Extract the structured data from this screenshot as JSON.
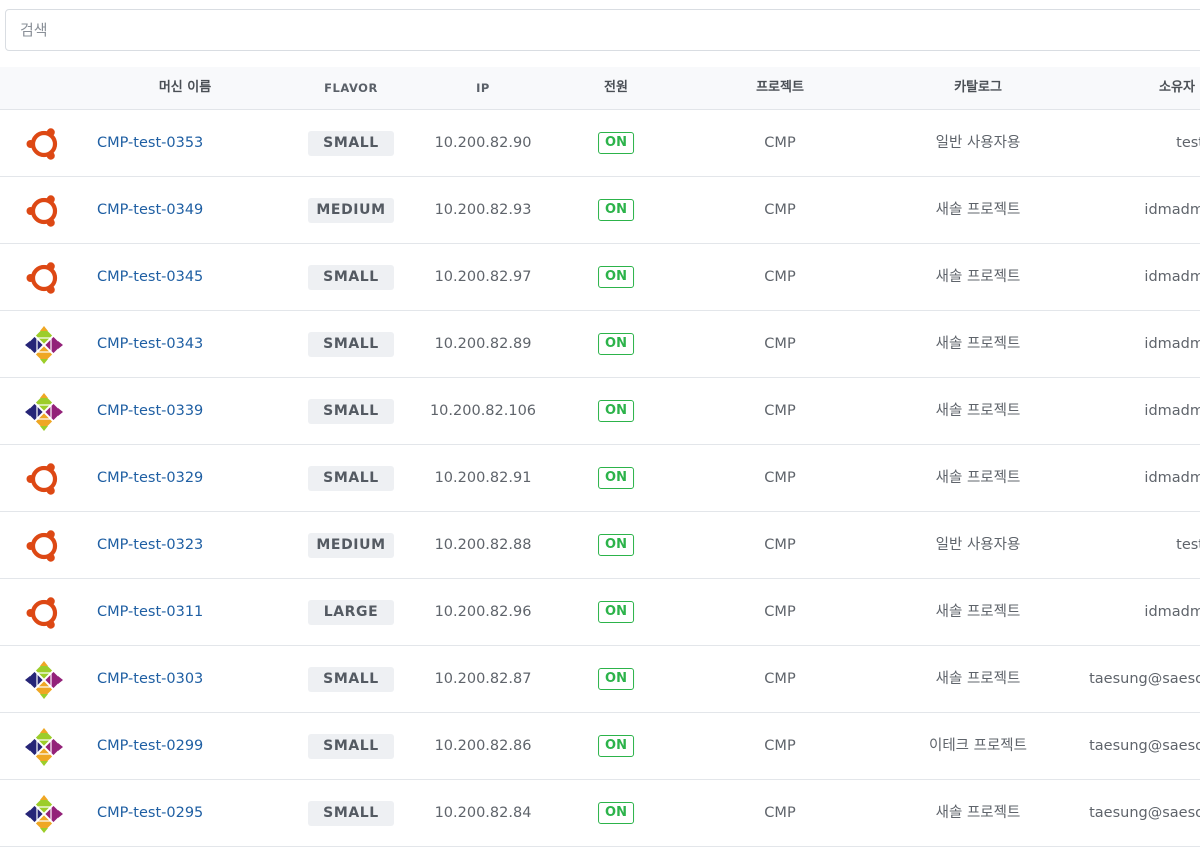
{
  "search": {
    "placeholder": "검색"
  },
  "columns": {
    "name": "머신 이름",
    "flavor": "FLAVOR",
    "ip": "IP",
    "power": "전원",
    "project": "프로젝트",
    "catalog": "카탈로그",
    "owner": "소유자"
  },
  "colors": {
    "link": "#1f5fa3",
    "power_on": "#2cb34a",
    "ubuntu": "#dd4814",
    "header_bg": "#f8f9fb"
  },
  "rows": [
    {
      "os_icon": "ubuntu-icon",
      "name": "CMP-test-0353",
      "flavor": "SMALL",
      "ip": "10.200.82.90",
      "power": "ON",
      "project": "CMP",
      "catalog": "일반 사용자용",
      "owner": "test"
    },
    {
      "os_icon": "ubuntu-icon",
      "name": "CMP-test-0349",
      "flavor": "MEDIUM",
      "ip": "10.200.82.93",
      "power": "ON",
      "project": "CMP",
      "catalog": "새솔 프로젝트",
      "owner": "idmadm"
    },
    {
      "os_icon": "ubuntu-icon",
      "name": "CMP-test-0345",
      "flavor": "SMALL",
      "ip": "10.200.82.97",
      "power": "ON",
      "project": "CMP",
      "catalog": "새솔 프로젝트",
      "owner": "idmadm"
    },
    {
      "os_icon": "centos-icon",
      "name": "CMP-test-0343",
      "flavor": "SMALL",
      "ip": "10.200.82.89",
      "power": "ON",
      "project": "CMP",
      "catalog": "새솔 프로젝트",
      "owner": "idmadm"
    },
    {
      "os_icon": "centos-icon",
      "name": "CMP-test-0339",
      "flavor": "SMALL",
      "ip": "10.200.82.106",
      "power": "ON",
      "project": "CMP",
      "catalog": "새솔 프로젝트",
      "owner": "idmadm"
    },
    {
      "os_icon": "ubuntu-icon",
      "name": "CMP-test-0329",
      "flavor": "SMALL",
      "ip": "10.200.82.91",
      "power": "ON",
      "project": "CMP",
      "catalog": "새솔 프로젝트",
      "owner": "idmadm"
    },
    {
      "os_icon": "ubuntu-icon",
      "name": "CMP-test-0323",
      "flavor": "MEDIUM",
      "ip": "10.200.82.88",
      "power": "ON",
      "project": "CMP",
      "catalog": "일반 사용자용",
      "owner": "test"
    },
    {
      "os_icon": "ubuntu-icon",
      "name": "CMP-test-0311",
      "flavor": "LARGE",
      "ip": "10.200.82.96",
      "power": "ON",
      "project": "CMP",
      "catalog": "새솔 프로젝트",
      "owner": "idmadm"
    },
    {
      "os_icon": "centos-icon",
      "name": "CMP-test-0303",
      "flavor": "SMALL",
      "ip": "10.200.82.87",
      "power": "ON",
      "project": "CMP",
      "catalog": "새솔 프로젝트",
      "owner": "taesung@saeso"
    },
    {
      "os_icon": "centos-icon",
      "name": "CMP-test-0299",
      "flavor": "SMALL",
      "ip": "10.200.82.86",
      "power": "ON",
      "project": "CMP",
      "catalog": "이테크 프로젝트",
      "owner": "taesung@saeso"
    },
    {
      "os_icon": "centos-icon",
      "name": "CMP-test-0295",
      "flavor": "SMALL",
      "ip": "10.200.82.84",
      "power": "ON",
      "project": "CMP",
      "catalog": "새솔 프로젝트",
      "owner": "taesung@saeso"
    }
  ]
}
